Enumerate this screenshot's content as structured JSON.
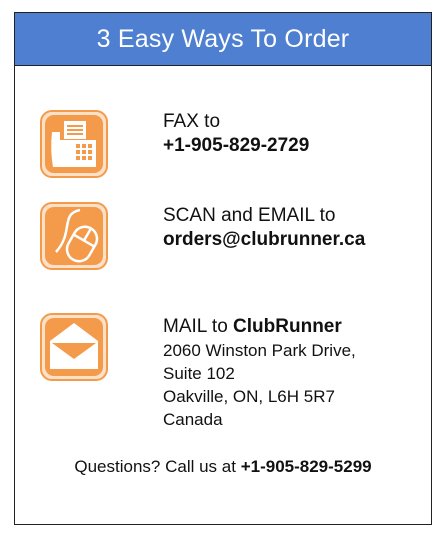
{
  "banner": {
    "title": "3 Easy Ways To Order"
  },
  "fax": {
    "label": "FAX to",
    "number": "+1-905-829-2729"
  },
  "scan": {
    "label": "SCAN and EMAIL to",
    "email": "orders@clubrunner.ca"
  },
  "mail": {
    "label": "MAIL to",
    "name": "ClubRunner",
    "address_lines": [
      "2060 Winston Park Drive,",
      "Suite 102",
      "Oakville, ON, L6H 5R7",
      "Canada"
    ]
  },
  "footer": {
    "text": "Questions? Call us at",
    "phone": "+1-905-829-5299"
  },
  "colors": {
    "banner": "#4f7fd0",
    "icon_orange": "#f49b4b",
    "icon_light": "#fce0c8"
  },
  "icons": [
    "fax-icon",
    "mouse-icon",
    "envelope-icon"
  ]
}
